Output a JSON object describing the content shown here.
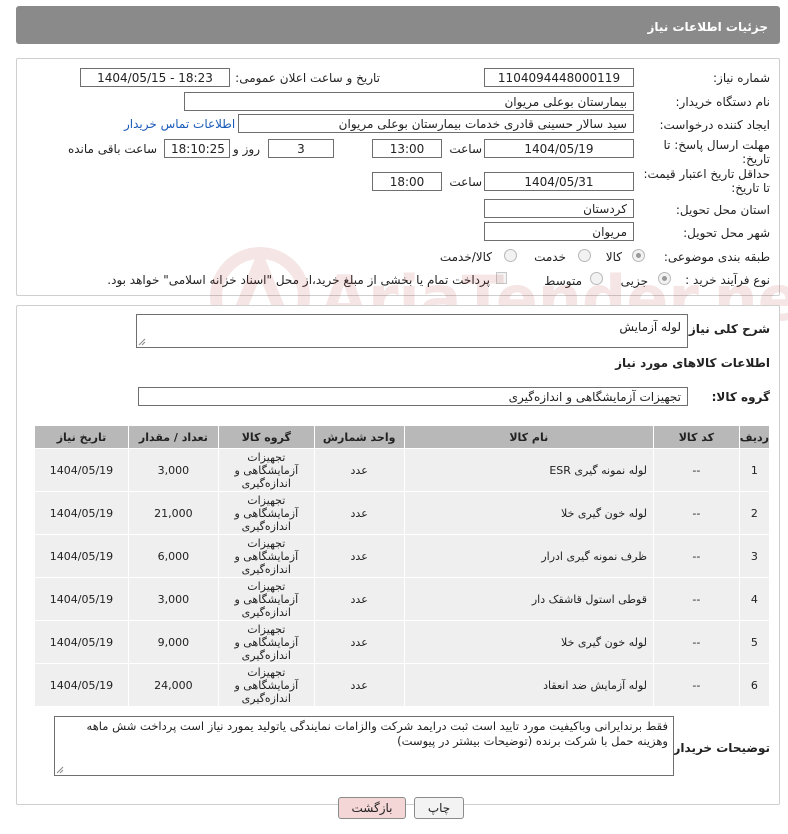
{
  "header": {
    "title": "جزئیات اطلاعات نیاز"
  },
  "form": {
    "need_number_label": "شماره نیاز:",
    "need_number": "1104094448000119",
    "announce_label": "تاریخ و ساعت اعلان عمومی:",
    "announce_value": "1404/05/15 - 18:23",
    "buyer_org_label": "نام دستگاه خریدار:",
    "buyer_org": "بیمارستان بوعلی مریوان",
    "requester_label": "ایجاد کننده درخواست:",
    "requester": "سید سالار حسینی قادری خدمات بیمارستان بوعلی مریوان",
    "buyer_contact_link": "اطلاعات تماس خریدار",
    "deadline_label": "مهلت ارسال پاسخ: تا تاریخ:",
    "deadline_date": "1404/05/19",
    "time_label": "ساعت",
    "deadline_time": "13:00",
    "days_count": "3",
    "days_label": "روز و",
    "remaining_time": "18:10:25",
    "remaining_label": "ساعت باقی مانده",
    "validity_label": "حداقل تاریخ اعتبار قیمت: تا تاریخ:",
    "validity_date": "1404/05/31",
    "validity_time": "18:00",
    "province_label": "استان محل تحویل:",
    "province": "کردستان",
    "city_label": "شهر محل تحویل:",
    "city": "مریوان",
    "category_label": "طبقه بندی موضوعی:",
    "category_options": [
      "کالا",
      "خدمت",
      "کالا/خدمت"
    ],
    "category_selected": "کالا",
    "process_label": "نوع فرآیند خرید :",
    "process_options": [
      "جزیی",
      "متوسط"
    ],
    "process_selected": "جزیی",
    "payment_note": "پرداخت تمام یا بخشی از مبلغ خرید،از محل \"اسناد خزانه اسلامی\" خواهد بود."
  },
  "description": {
    "label": "شرح کلی نیاز:",
    "value": "لوله آزمایش",
    "goods_info_title": "اطلاعات کالاهای مورد نیاز",
    "goods_group_label": "گروه کالا:",
    "goods_group": "تجهیزات آزمایشگاهی و اندازه‌گیری"
  },
  "table": {
    "headers": [
      "ردیف",
      "کد کالا",
      "نام کالا",
      "واحد شمارش",
      "گروه کالا",
      "تعداد / مقدار",
      "تاریخ نیاز"
    ],
    "rows": [
      [
        "1",
        "--",
        "لوله نمونه گیری ESR",
        "عدد",
        "تجهیزات آزمایشگاهی و اندازه‌گیری",
        "3,000",
        "1404/05/19"
      ],
      [
        "2",
        "--",
        "لوله خون گیری خلا",
        "عدد",
        "تجهیزات آزمایشگاهی و اندازه‌گیری",
        "21,000",
        "1404/05/19"
      ],
      [
        "3",
        "--",
        "ظرف نمونه گیری ادرار",
        "عدد",
        "تجهیزات آزمایشگاهی و اندازه‌گیری",
        "6,000",
        "1404/05/19"
      ],
      [
        "4",
        "--",
        "قوطی استول قاشقک دار",
        "عدد",
        "تجهیزات آزمایشگاهی و اندازه‌گیری",
        "3,000",
        "1404/05/19"
      ],
      [
        "5",
        "--",
        "لوله خون گیری خلا",
        "عدد",
        "تجهیزات آزمایشگاهی و اندازه‌گیری",
        "9,000",
        "1404/05/19"
      ],
      [
        "6",
        "--",
        "لوله آزمایش ضد انعقاد",
        "عدد",
        "تجهیزات آزمایشگاهی و اندازه‌گیری",
        "24,000",
        "1404/05/19"
      ]
    ]
  },
  "buyer_notes": {
    "label": "توضیحات خریدار:",
    "value": "فقط برندایرانی وباکیفیت مورد تایید است ثبت درایمد شرکت والزامات نمایندگی یاتولید یمورد نیاز است پرداخت شش ماهه وهزینه حمل با شرکت برنده (توضیحات بیشتر در پیوست)"
  },
  "buttons": {
    "print": "چاپ",
    "back": "بازگشت"
  },
  "colors": {
    "title_bar": "#8a8a8a",
    "table_header": "#b8b8b8",
    "link": "#1a5bb8",
    "back_button": "#f4d6d6"
  }
}
